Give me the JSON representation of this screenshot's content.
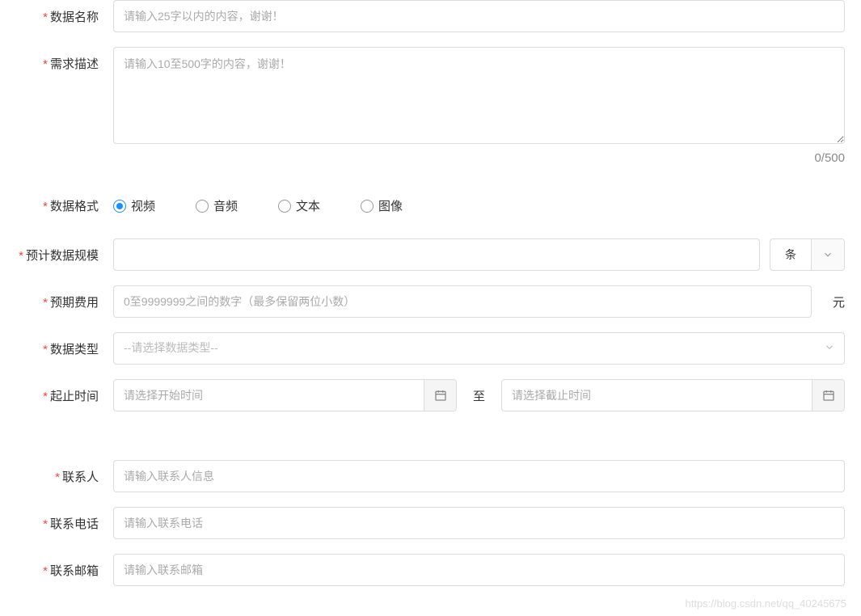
{
  "fields": {
    "data_name": {
      "label": "数据名称",
      "placeholder": "请输入25字以内的内容，谢谢！"
    },
    "requirement_desc": {
      "label": "需求描述",
      "placeholder": "请输入10至500字的内容，谢谢！",
      "counter": "0/500"
    },
    "data_format": {
      "label": "数据格式",
      "options": [
        "视频",
        "音频",
        "文本",
        "图像"
      ],
      "selected": "视频"
    },
    "estimated_scale": {
      "label": "预计数据规模",
      "value": "",
      "unit": "条"
    },
    "expected_cost": {
      "label": "预期费用",
      "placeholder": "0至9999999之间的数字（最多保留两位小数）",
      "unit": "元"
    },
    "data_type": {
      "label": "数据类型",
      "placeholder": "--请选择数据类型--"
    },
    "time_range": {
      "label": "起止时间",
      "start_placeholder": "请选择开始时间",
      "separator": "至",
      "end_placeholder": "请选择截止时间"
    },
    "contact_person": {
      "label": "联系人",
      "placeholder": "请输入联系人信息"
    },
    "contact_phone": {
      "label": "联系电话",
      "placeholder": "请输入联系电话"
    },
    "contact_email": {
      "label": "联系邮箱",
      "placeholder": "请输入联系邮箱"
    }
  },
  "watermark": "https://blog.csdn.net/qq_40245675"
}
